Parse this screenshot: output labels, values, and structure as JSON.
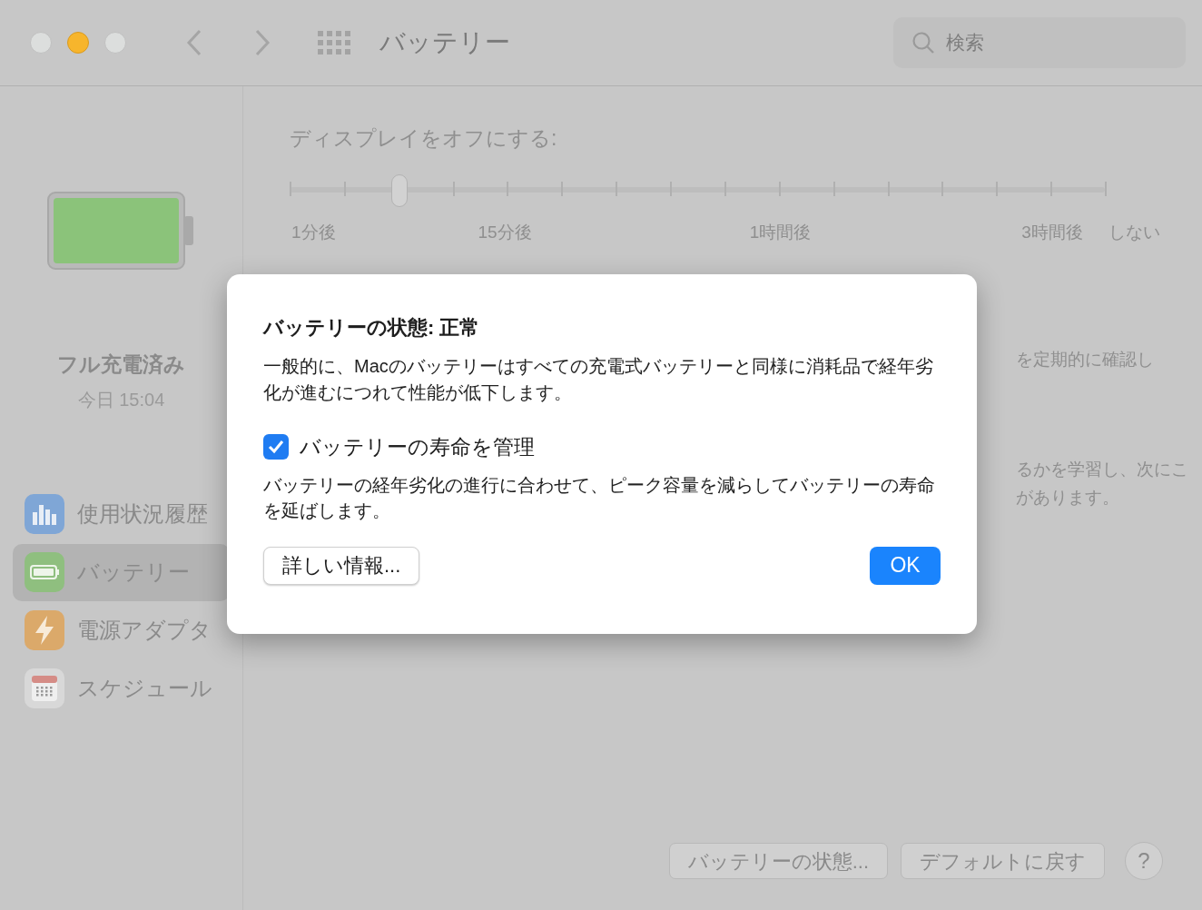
{
  "window": {
    "title": "バッテリー"
  },
  "search": {
    "placeholder": "検索"
  },
  "sidebar": {
    "status": "フル充電済み",
    "time": "今日 15:04",
    "charge": {
      "level": 1
    },
    "items": [
      {
        "label": "使用状況履歴",
        "kind": "chart",
        "selected": false
      },
      {
        "label": "バッテリー",
        "kind": "battery",
        "selected": true
      },
      {
        "label": "電源アダプタ",
        "kind": "power",
        "selected": false
      },
      {
        "label": "スケジュール",
        "kind": "calendar",
        "selected": false
      }
    ]
  },
  "display_off": {
    "label": "ディスプレイをオフにする:",
    "level": 0.1333,
    "ticks": [
      "1分後",
      "15分後",
      "1時間後",
      "3時間後",
      "しない"
    ]
  },
  "background_texts": [
    "を定期的に確認し",
    "るかを学習し、次にこ",
    "があります。"
  ],
  "buttons": [
    "バッテリーの状態...",
    "デフォルトに戻す",
    "?"
  ],
  "dialog": {
    "title": "バッテリーの状態: 正常",
    "body": "一般的に、Macのバッテリーはすべての充電式バッテリーと同様に消耗品で経年劣化が進むにつれて性能が低下します。",
    "option": {
      "label": "バッテリーの寿命を管理",
      "checked": true
    },
    "option_note": "バッテリーの経年劣化の進行に合わせて、ピーク容量を減らしてバッテリーの寿命を延ばします。",
    "more_button": "詳しい情報...",
    "ok_button": "OK"
  }
}
